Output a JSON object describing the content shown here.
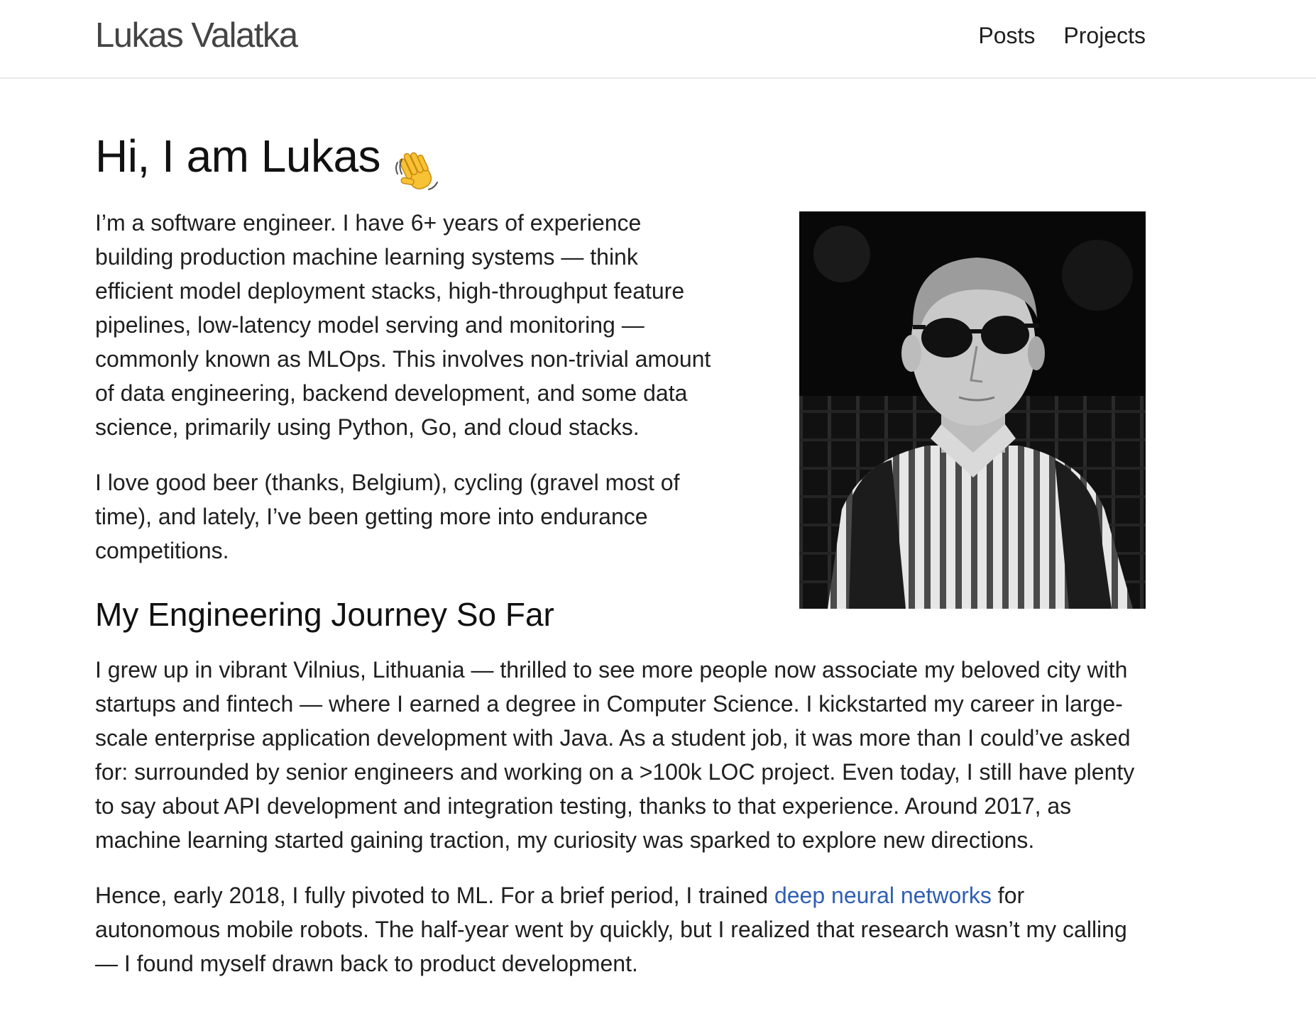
{
  "header": {
    "site_title": "Lukas Valatka",
    "nav": {
      "posts_label": "Posts",
      "projects_label": "Projects"
    }
  },
  "intro": {
    "greeting": "Hi, I am Lukas",
    "greeting_emoji": "waving-hand",
    "paragraph1": "I’m a software engineer. I have 6+ years of experience building production machine learning systems — think efficient model deployment stacks, high-throughput feature pipelines, low-latency model serving and monitoring — commonly known as MLOps. This involves non-trivial amount of data engineering, backend development, and some data science, primarily using Python, Go, and cloud stacks.",
    "paragraph2": "I love good beer (thanks, Belgium), cycling (gravel most of time), and lately, I’ve been getting more into endurance competitions."
  },
  "journey": {
    "heading": "My Engineering Journey So Far",
    "paragraph1": "I grew up in vibrant Vilnius, Lithuania — thrilled to see more people now associate my beloved city with startups and fintech — where I earned a degree in Computer Science. I kickstarted my career in large-scale enterprise application development with Java. As a student job, it was more than I could’ve asked for: surrounded by senior engineers and working on a >100k LOC project. Even today, I still have plenty to say about API development and integration testing, thanks to that experience. Around 2017, as machine learning started gaining traction, my curiosity was sparked to explore new directions.",
    "paragraph2_before_link": "Hence, early 2018, I fully pivoted to ML. For a brief period, I trained ",
    "paragraph2_link": "deep neural networks",
    "paragraph2_after_link": " for autonomous mobile robots. The half-year went by quickly, but I realized that research wasn’t my calling — I found myself drawn back to product development."
  },
  "colors": {
    "link": "#2f5fb3",
    "title": "#444444",
    "text": "#1f1f1f"
  }
}
